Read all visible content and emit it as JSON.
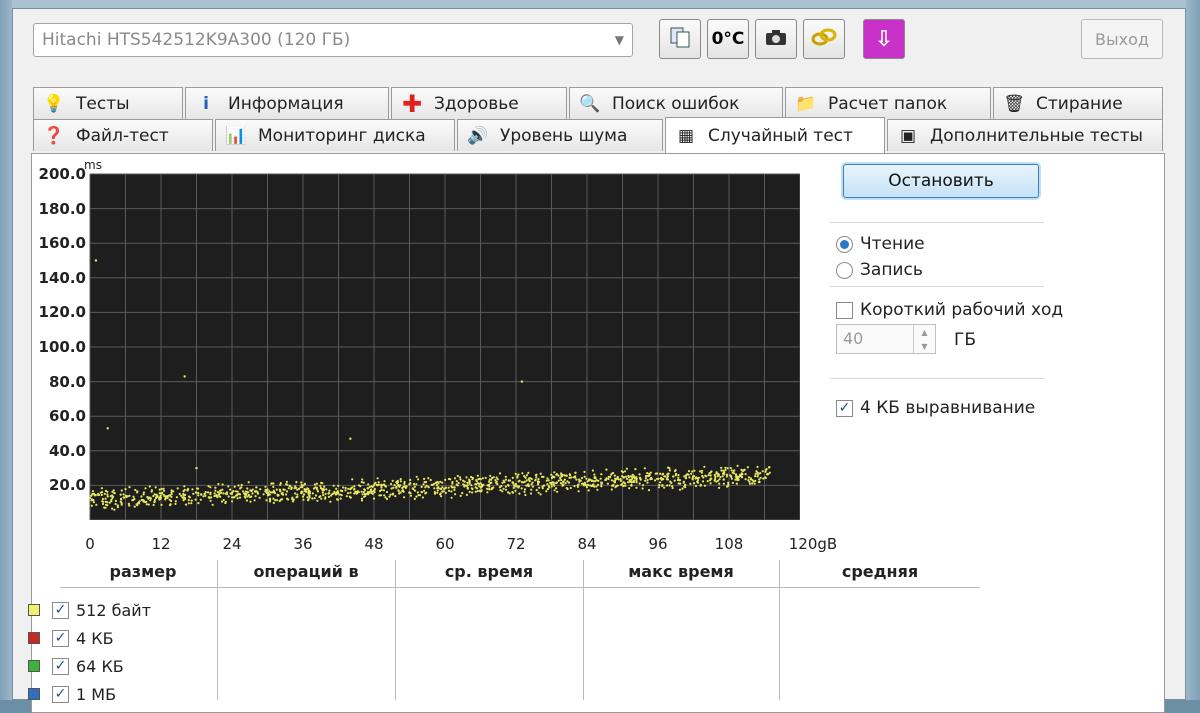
{
  "toolbar": {
    "drive_select": "Hitachi HTS542512K9A300 (120 ГБ)",
    "temp_button": "0°C",
    "exit_button": "Выход",
    "icons": [
      "copy-icon",
      "temperature-icon",
      "camera-icon",
      "link-icon",
      "download-icon"
    ]
  },
  "tabs_row1": [
    {
      "label": "Тесты",
      "icon": "lightbulb-icon"
    },
    {
      "label": "Информация",
      "icon": "info-icon"
    },
    {
      "label": "Здоровье",
      "icon": "health-cross-icon"
    },
    {
      "label": "Поиск ошибок",
      "icon": "magnifier-icon"
    },
    {
      "label": "Расчет папок",
      "icon": "folder-icon"
    },
    {
      "label": "Стирание",
      "icon": "trash-icon"
    }
  ],
  "tabs_row2": [
    {
      "label": "Файл-тест",
      "icon": "file-test-icon"
    },
    {
      "label": "Мониторинг диска",
      "icon": "monitor-chart-icon"
    },
    {
      "label": "Уровень шума",
      "icon": "speaker-icon"
    },
    {
      "label": "Случайный тест",
      "icon": "random-test-icon"
    },
    {
      "label": "Дополнительные тесты",
      "icon": "extra-tests-icon"
    }
  ],
  "controls": {
    "stop_button": "Остановить",
    "read_label": "Чтение",
    "write_label": "Запись",
    "short_stroke_label": "Короткий рабочий ход",
    "short_stroke_value": "40",
    "gb_unit": "ГБ",
    "align_label": "4 КБ выравнивание"
  },
  "chart_data": {
    "type": "scatter",
    "ylabel": "ms",
    "y_ticks": [
      "200.0",
      "180.0",
      "160.0",
      "140.0",
      "120.0",
      "100.0",
      "80.0",
      "60.0",
      "40.0",
      "20.0"
    ],
    "x_ticks": [
      "0",
      "12",
      "24",
      "36",
      "48",
      "60",
      "72",
      "84",
      "96",
      "108",
      "120gB"
    ],
    "xlim": [
      0,
      120
    ],
    "ylim": [
      0,
      200
    ],
    "grid": true,
    "background": "#1e1e1e",
    "series": [
      {
        "color": "#e8e860",
        "trend_start_ms": 12,
        "trend_end_ms": 26,
        "spread_ms": 7
      }
    ],
    "outliers": [
      [
        1,
        150
      ],
      [
        16,
        83
      ],
      [
        3,
        53
      ],
      [
        44,
        47
      ],
      [
        73,
        80
      ],
      [
        18,
        30
      ]
    ]
  },
  "table": {
    "headers": [
      "размер",
      "операций в",
      "ср. время",
      "макс время",
      "средняя"
    ],
    "rows": [
      {
        "color": "#f0f070",
        "label": "512 байт"
      },
      {
        "color": "#c62828",
        "label": "4 КБ"
      },
      {
        "color": "#3cb43c",
        "label": "64 КБ"
      },
      {
        "color": "#2f6fc0",
        "label": "1 МБ"
      }
    ]
  }
}
